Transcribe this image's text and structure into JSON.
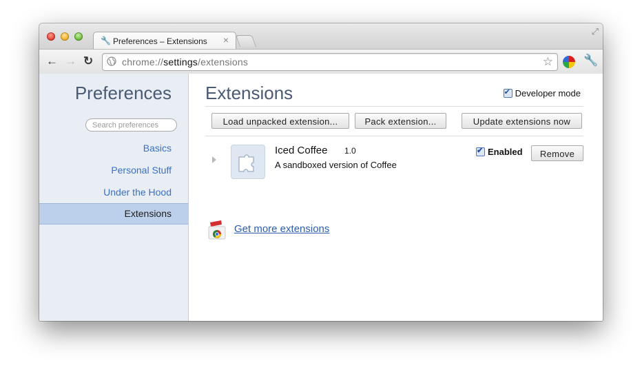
{
  "tab": {
    "title": "Preferences – Extensions",
    "close_glyph": "×"
  },
  "toolbar": {
    "url_scheme": "chrome://",
    "url_host": "settings",
    "url_path": "/extensions",
    "back_glyph": "←",
    "forward_glyph": "→",
    "reload_glyph": "↻",
    "star_glyph": "☆",
    "wrench_glyph": "🔧"
  },
  "sidebar": {
    "title": "Preferences",
    "search_placeholder": "Search preferences",
    "items": [
      {
        "label": "Basics",
        "selected": false
      },
      {
        "label": "Personal Stuff",
        "selected": false
      },
      {
        "label": "Under the Hood",
        "selected": false
      },
      {
        "label": "Extensions",
        "selected": true
      }
    ]
  },
  "main": {
    "title": "Extensions",
    "developer_mode": {
      "label": "Developer mode",
      "checked": true
    },
    "buttons": {
      "load": "Load unpacked extension...",
      "pack": "Pack extension...",
      "update": "Update extensions now"
    },
    "extension": {
      "name": "Iced Coffee",
      "version": "1.0",
      "description": "A sandboxed version of Coffee",
      "enabled_label": "Enabled",
      "enabled": true,
      "remove_label": "Remove"
    },
    "more_link": "Get more extensions"
  },
  "icons": [
    "wrench-icon",
    "close-icon",
    "back-icon",
    "forward-icon",
    "reload-icon",
    "globe-icon",
    "star-icon",
    "puzzle-icon",
    "web-store-icon",
    "fullscreen-icon"
  ]
}
